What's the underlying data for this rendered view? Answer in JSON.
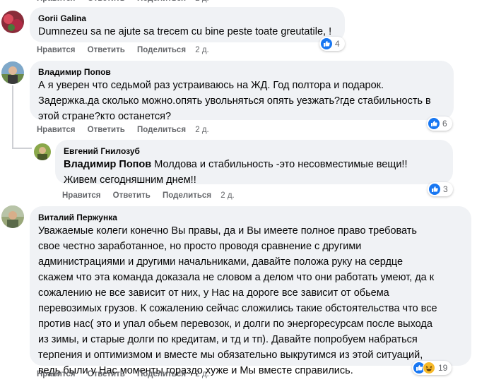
{
  "actions": {
    "like": "Нравится",
    "reply": "Ответить",
    "share": "Поделиться",
    "time": "2 д."
  },
  "comments": [
    {
      "author": "Gorii Galina",
      "text": "Dumnezeu sa ne ajute sa trecem cu bine peste toate greutatile, !",
      "reactions": "4"
    },
    {
      "author": "Владимир Попов",
      "text": "А я уверен что седьмой раз устраиваюсь на ЖД. Год полтора и подарок.\nЗадержка.да сколько можно.опять увольняться опять уезжать?где стабильность в\nэтой стране?кто останется?",
      "reactions": "6"
    },
    {
      "author": "Евгений Гнилозуб",
      "mention": "Владимир Попов",
      "text": " Молдова и стабильность -это несовместимые вещи!!\nЖивем сегодняшним днем!!",
      "reactions": "3"
    },
    {
      "author": "Виталий Пержунка",
      "text": "Уважаемые колеги конечно Вы правы, да и Вы имеете полное право требовать\nсвое честно заработанное, но просто проводя сравнение с другими\nадминистрациями и другими начальниками, давайте положа руку на сердце\nскажем что эта команда доказала не словом а делом что они работать умеют, да к\nсожалению не все зависит от них, у Нас на дороге все зависит от обьема\nперевозимых грузов. К сожалению сейчас сложились такие обстоятельства что все\nпротив нас( это и упал обьем перевозок, и долги по энергоресурсам после выхода\nиз зимы, и старые долги по кредитам, и тд и тп). Давайте попробуем набраться\nтерпения и оптимизмом и вместе мы обязательно выкрутимся из этой ситуаций,\nведь были у Нас моменты гораздо хуже и Мы вместе справились.",
      "reactions": "19"
    }
  ],
  "colors": {
    "bubble": "#f0f2f5",
    "like": "#1877f2",
    "haha": "#f7b928",
    "meta": "#65676b"
  }
}
